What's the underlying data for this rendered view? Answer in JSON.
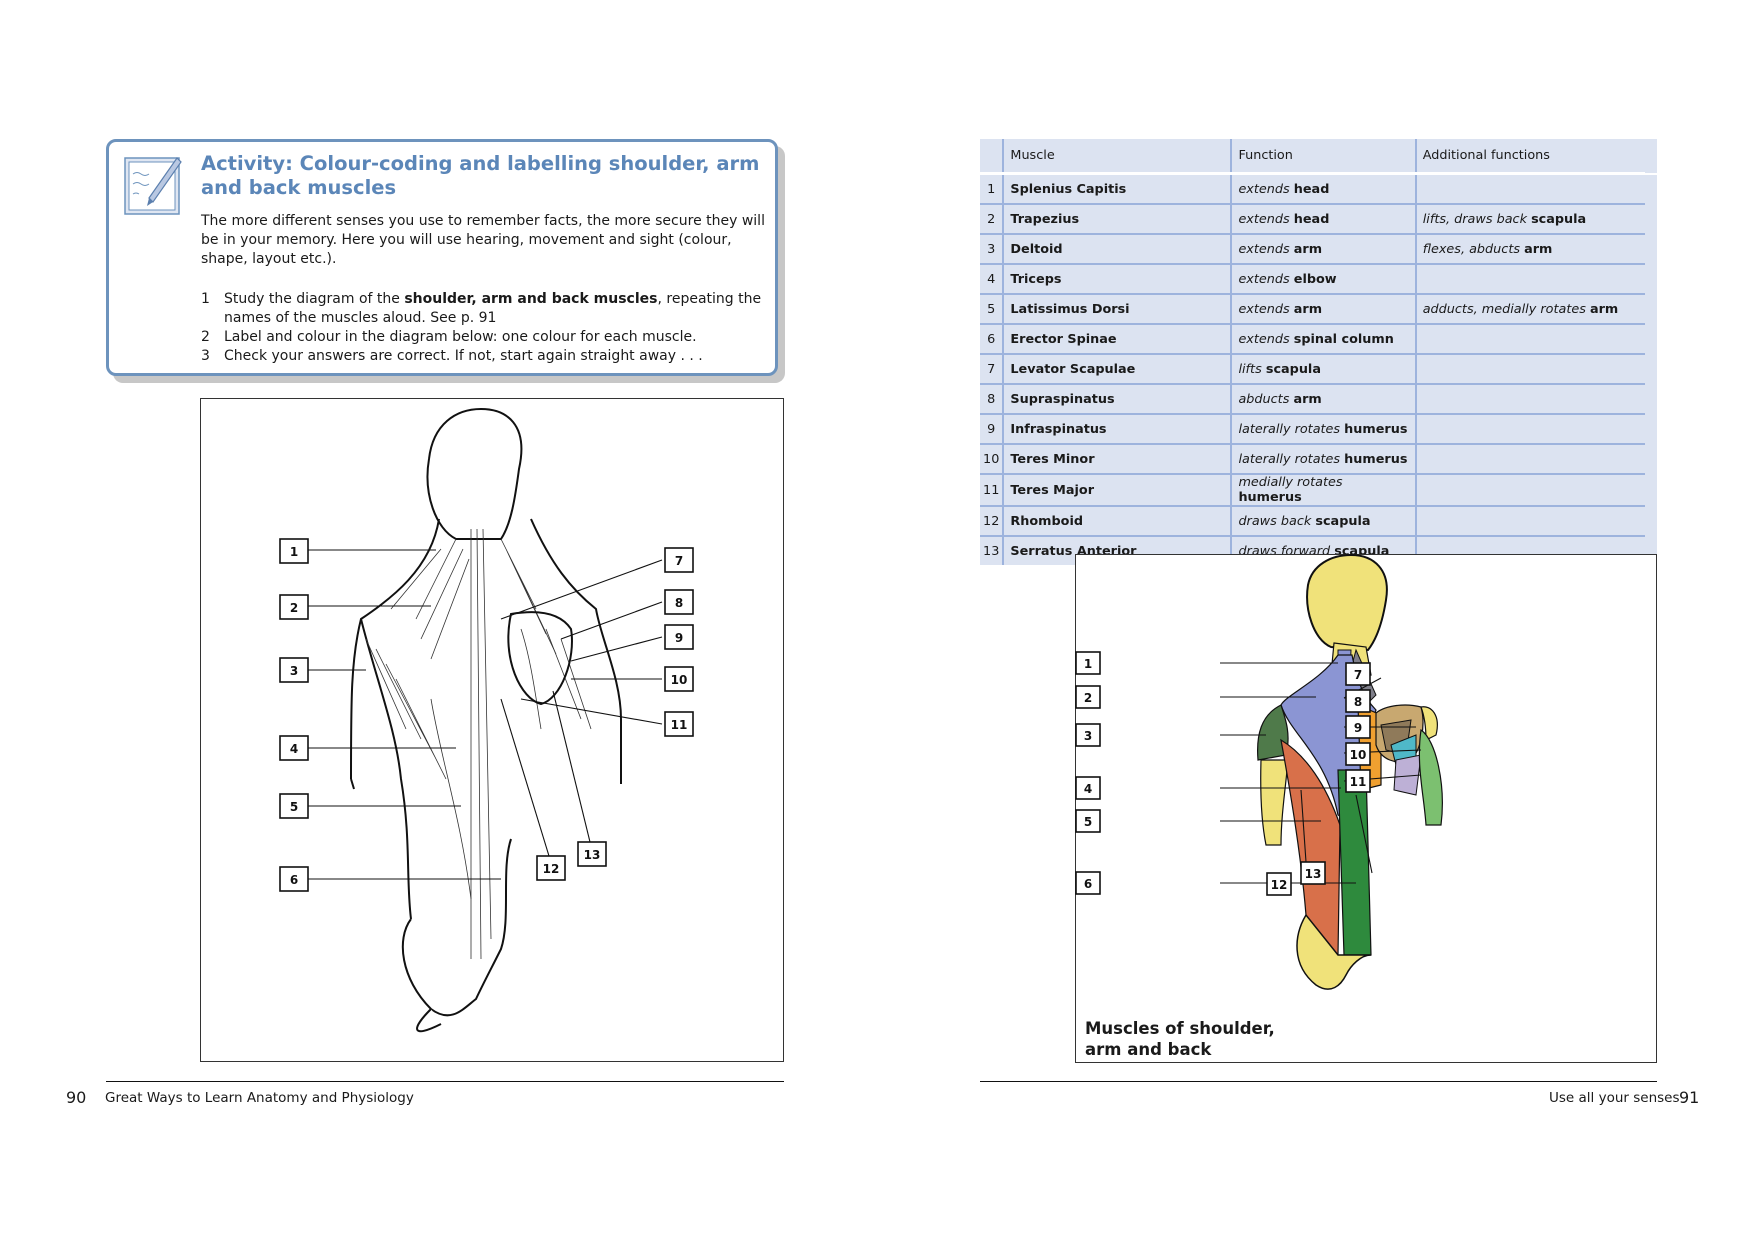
{
  "left_page": {
    "activity": {
      "title": "Activity: Colour-coding and labelling shoulder, arm and back muscles",
      "intro": "The more different senses you use to remember facts, the more secure they will be in your memory. Here you will use hearing, movement and sight (colour, shape, layout etc.).",
      "steps": [
        {
          "num": "1",
          "before": "Study the diagram of the ",
          "bold": "shoulder, arm and back muscles",
          "after": ", repeating the names of the muscles aloud. See p. 91"
        },
        {
          "num": "2",
          "text": "Label and colour in the diagram below: one colour for each muscle."
        },
        {
          "num": "3",
          "text": "Check your answers are correct. If not, start again straight away . . ."
        }
      ],
      "icon": "notepad-pen-icon"
    },
    "labels": [
      "1",
      "2",
      "3",
      "4",
      "5",
      "6",
      "7",
      "8",
      "9",
      "10",
      "11",
      "12",
      "13"
    ],
    "page_number": "90",
    "running_head": "Great Ways to Learn Anatomy and Physiology"
  },
  "right_page": {
    "table": {
      "headers": {
        "muscle": "Muscle",
        "function": "Function",
        "additional": "Additional functions"
      },
      "rows": [
        {
          "num": "1",
          "muscle": "Splenius Capitis",
          "func_verb": "extends",
          "func_obj": "head",
          "add_verb": "",
          "add_obj": ""
        },
        {
          "num": "2",
          "muscle": "Trapezius",
          "func_verb": "extends",
          "func_obj": "head",
          "add_verb": "lifts, draws back",
          "add_obj": "scapula"
        },
        {
          "num": "3",
          "muscle": "Deltoid",
          "func_verb": "extends",
          "func_obj": "arm",
          "add_verb": "flexes, abducts",
          "add_obj": "arm"
        },
        {
          "num": "4",
          "muscle": "Triceps",
          "func_verb": "extends",
          "func_obj": "elbow",
          "add_verb": "",
          "add_obj": ""
        },
        {
          "num": "5",
          "muscle": "Latissimus Dorsi",
          "func_verb": "extends",
          "func_obj": "arm",
          "add_verb": "adducts, medially rotates",
          "add_obj": "arm"
        },
        {
          "num": "6",
          "muscle": "Erector Spinae",
          "func_verb": "extends",
          "func_obj": "spinal column",
          "add_verb": "",
          "add_obj": ""
        },
        {
          "num": "7",
          "muscle": "Levator Scapulae",
          "func_verb": "lifts",
          "func_obj": "scapula",
          "add_verb": "",
          "add_obj": ""
        },
        {
          "num": "8",
          "muscle": "Supraspinatus",
          "func_verb": "abducts",
          "func_obj": "arm",
          "add_verb": "",
          "add_obj": ""
        },
        {
          "num": "9",
          "muscle": "Infraspinatus",
          "func_verb": "laterally rotates",
          "func_obj": "humerus",
          "add_verb": "",
          "add_obj": ""
        },
        {
          "num": "10",
          "muscle": "Teres Minor",
          "func_verb": "laterally rotates",
          "func_obj": "humerus",
          "add_verb": "",
          "add_obj": ""
        },
        {
          "num": "11",
          "muscle": "Teres Major",
          "func_verb": "medially rotates",
          "func_obj": "humerus",
          "add_verb": "",
          "add_obj": ""
        },
        {
          "num": "12",
          "muscle": "Rhomboid",
          "func_verb": "draws back",
          "func_obj": "scapula",
          "add_verb": "",
          "add_obj": ""
        },
        {
          "num": "13",
          "muscle": "Serratus Anterior",
          "func_verb": "draws forward",
          "func_obj": "scapula",
          "add_verb": "",
          "add_obj": ""
        }
      ]
    },
    "labels": [
      "1",
      "2",
      "3",
      "4",
      "5",
      "6",
      "7",
      "8",
      "9",
      "10",
      "11",
      "12",
      "13"
    ],
    "caption_line1": "Muscles of shoulder,",
    "caption_line2": "arm and back",
    "page_number": "91",
    "running_head": "Use all your senses"
  },
  "colors": {
    "accent_blue": "#6d93bd",
    "title_blue": "#5b86b8",
    "table_bg": "#dce3f1",
    "table_rule": "#9db3dd",
    "skin_yellow": "#f0e27a",
    "trapezius_blue": "#8b95d3",
    "latissimus_red": "#d8704a",
    "erector_green": "#2e8a3d",
    "deltoid_green": "#4f7a4a",
    "rhomboid_orange": "#f0a030",
    "triceps_green": "#7cc070",
    "teres_major_mauve": "#bdb0d6"
  }
}
